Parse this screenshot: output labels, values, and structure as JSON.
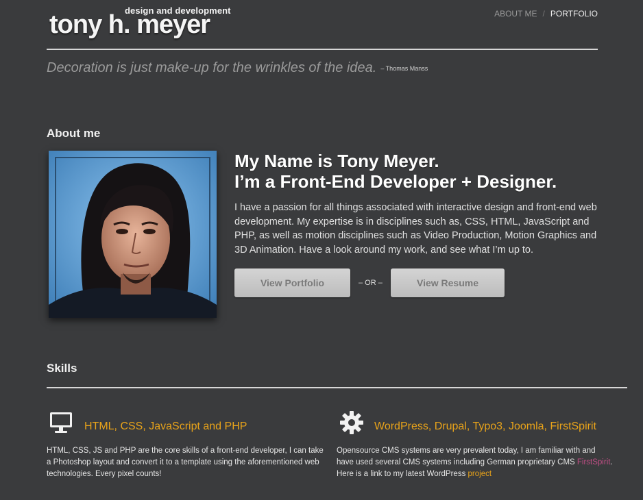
{
  "header": {
    "logo_sub": "design and development",
    "logo_main": "tony h. meyer",
    "nav": {
      "about": "ABOUT ME",
      "separator": "/",
      "portfolio": "PORTFOLIO"
    }
  },
  "quote": {
    "text": "Decoration is just make-up for the wrinkles of the idea.",
    "author": "– Thomas Manss"
  },
  "about": {
    "title": "About me",
    "headline_line1": "My Name is Tony Meyer.",
    "headline_line2": "I’m a Front-End Developer + Designer.",
    "bio": "I have a passion for all things associated with interactive design and front-end web development. My expertise is in disciplines such as, CSS, HTML, JavaScript and PHP, as well as motion disciplines such as Video Production, Motion Graphics and 3D Animation. Have a look around my work, and see what I’m up to.",
    "btn_portfolio": "View Portfolio",
    "or_text": "– OR –",
    "btn_resume": "View Resume"
  },
  "skills": {
    "title": "Skills",
    "items": [
      {
        "icon": "monitor-icon",
        "title": "HTML, CSS, JavaScript and PHP",
        "text": "HTML, CSS, JS and PHP are the core skills of a front-end developer, I can take a Photoshop layout and convert it to a template using the aforementioned web technologies. Every pixel counts!"
      },
      {
        "icon": "gear-icon",
        "title": "WordPress, Drupal, Typo3, Joomla, FirstSpirit",
        "text_before": "Opensource CMS systems are very prevalent today, I am familiar with and have used several CMS systems including German proprietary CMS ",
        "link1": "FirstSpirit",
        "text_middle": ". Here is a link to my latest WordPress ",
        "link2": "project"
      }
    ]
  },
  "colors": {
    "background": "#3a3b3d",
    "accent": "#e8a31a",
    "link_pink": "#c24e86"
  }
}
